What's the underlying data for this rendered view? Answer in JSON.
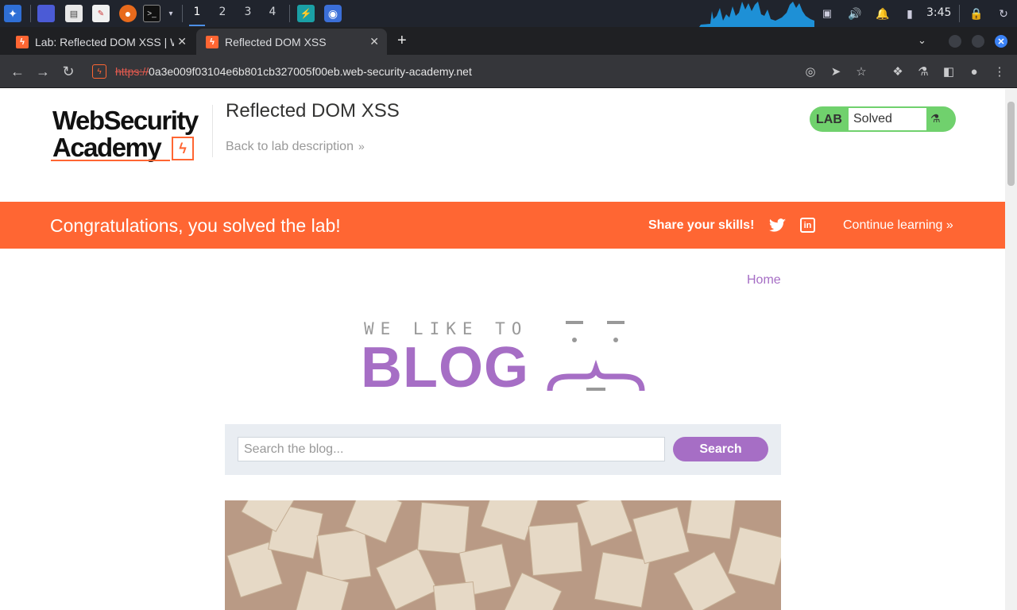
{
  "taskbar": {
    "workspaces": [
      "1",
      "2",
      "3",
      "4"
    ],
    "active_workspace": "1",
    "clock": "3:45",
    "icons": [
      "kali-menu-icon",
      "desktop-icon",
      "files-icon",
      "text-editor-icon",
      "firefox-icon",
      "terminal-icon",
      "burp-icon",
      "chromium-icon",
      "display-icon",
      "volume-icon",
      "bell-icon",
      "battery-icon",
      "lock-icon",
      "power-icon"
    ]
  },
  "browser": {
    "tabs": [
      {
        "title": "Lab: Reflected DOM XSS | Web Security Academy",
        "active": false
      },
      {
        "title": "Reflected DOM XSS",
        "active": true
      }
    ],
    "url_protocol": "https://",
    "url_rest": "0a3e009f03104e6b801cb327005f00eb.web-security-academy.net"
  },
  "academy_header": {
    "logo_line1": "WebSecurity",
    "logo_line2": "Academy",
    "lab_title": "Reflected DOM XSS",
    "back_link": "Back to lab description",
    "status_label": "LAB",
    "status_value": "Solved"
  },
  "banner": {
    "message": "Congratulations, you solved the lab!",
    "share_label": "Share your skills!",
    "continue_link": "Continue learning"
  },
  "blog": {
    "home_link": "Home",
    "tagline": "WE LIKE TO",
    "wordmark": "BLOG",
    "search_placeholder": "Search the blog...",
    "search_button": "Search"
  },
  "colors": {
    "accent_orange": "#ff6633",
    "blog_purple": "#a66ec5",
    "solved_green": "#70d16d"
  }
}
